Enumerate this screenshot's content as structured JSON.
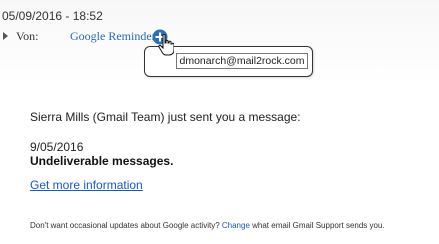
{
  "header": {
    "datetime": "05/09/2016 - 18:52",
    "from_label": "Von:",
    "sender_name": "Google Reminder",
    "sender_email": "dmonarch@mail2rock.com"
  },
  "body": {
    "intro": "Sierra Mills (Gmail Team) just sent you a message:",
    "message_date": "9/05/2016",
    "message_subject": "Undeliverable messages.",
    "link_text": "Get more information"
  },
  "footer": {
    "text_before": "Don't want occasional updates about Google activity? ",
    "change_link": "Change",
    "text_after": " what email Gmail Support sends you."
  },
  "colors": {
    "link": "#1a5bb8",
    "sender": "#2c6ab0",
    "add_icon": "#2f6fb3"
  },
  "icons": [
    "add-contact-icon",
    "cursor-hand-icon",
    "expand-triangle-icon"
  ]
}
